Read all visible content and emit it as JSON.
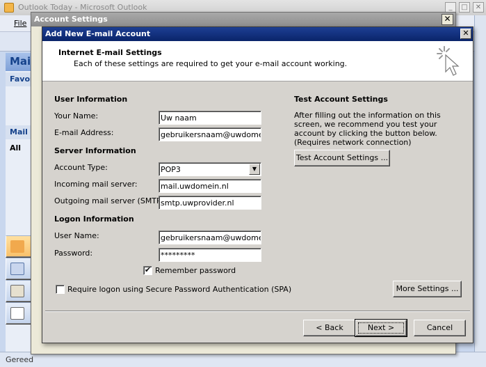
{
  "outlook": {
    "window_title": "Outlook Today - Microsoft Outlook",
    "menu_file": "File",
    "nav_header": "Mai",
    "nav_favorites": "Favor",
    "nav_mail": "Mail",
    "nav_all": "All",
    "status": "Gereed"
  },
  "account_settings": {
    "title": "Account Settings",
    "close": "✕"
  },
  "dialog": {
    "title": "Add New E-mail Account",
    "close": "✕",
    "header_title": "Internet E-mail Settings",
    "header_subtitle": "Each of these settings are required to get your e-mail account working.",
    "user_info": {
      "heading": "User Information",
      "your_name_label": "Your Name:",
      "your_name_value": "Uw naam",
      "email_label": "E-mail Address:",
      "email_value": "gebruikersnaam@uwdomein.nl"
    },
    "server_info": {
      "heading": "Server Information",
      "account_type_label": "Account Type:",
      "account_type_value": "POP3",
      "incoming_label": "Incoming mail server:",
      "incoming_value": "mail.uwdomein.nl",
      "outgoing_label": "Outgoing mail server (SMTP):",
      "outgoing_value": "smtp.uwprovider.nl"
    },
    "logon_info": {
      "heading": "Logon Information",
      "user_name_label": "User Name:",
      "user_name_value": "gebruikersnaam@uwdomein.nl",
      "password_label": "Password:",
      "password_value": "*********",
      "remember_label": "Remember password",
      "remember_checked": true,
      "spa_label": "Require logon using Secure Password Authentication (SPA)",
      "spa_checked": false
    },
    "test": {
      "heading": "Test Account Settings",
      "description": "After filling out the information on this screen, we recommend you test your account by clicking the button below. (Requires network connection)",
      "button": "Test Account Settings ..."
    },
    "more_settings_button": "More Settings ...",
    "back_button": "< Back",
    "next_button": "Next >",
    "cancel_button": "Cancel"
  }
}
